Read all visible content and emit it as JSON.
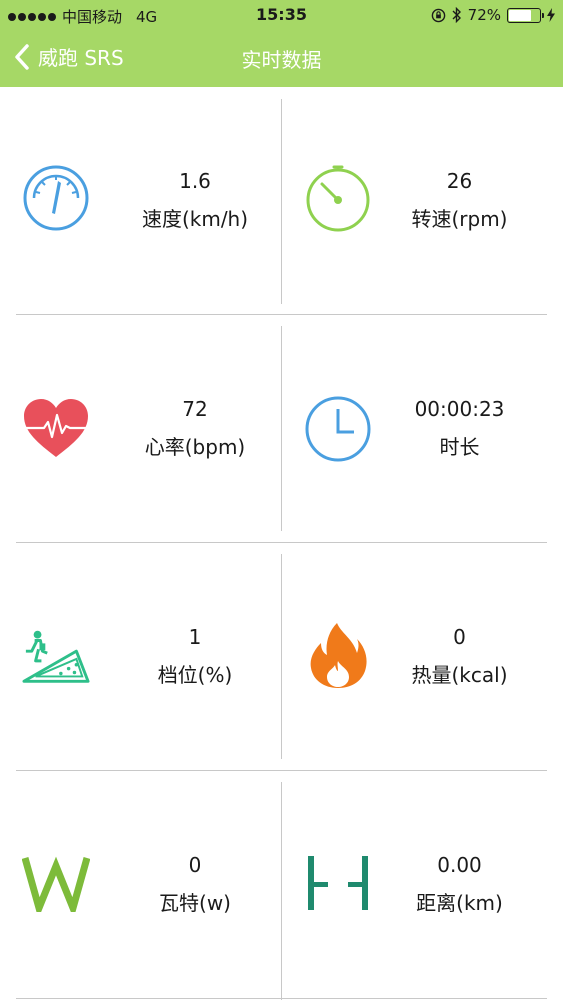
{
  "status_bar": {
    "carrier": "中国移动",
    "network": "4G",
    "time": "15:35",
    "battery": "72%",
    "battery_level": 0.72
  },
  "nav": {
    "back_label": "威跑 SRS",
    "title": "实时数据"
  },
  "metrics": [
    {
      "value": "1.6",
      "label": "速度(km/h)",
      "icon": "speedometer-icon",
      "color": "#4a9fe0"
    },
    {
      "value": "26",
      "label": "转速(rpm)",
      "icon": "rpm-dial-icon",
      "color": "#8fd14f"
    },
    {
      "value": "72",
      "label": "心率(bpm)",
      "icon": "heart-rate-icon",
      "color": "#e8505b"
    },
    {
      "value": "00:00:23",
      "label": "时长",
      "icon": "clock-icon",
      "color": "#4a9fe0"
    },
    {
      "value": "1",
      "label": "档位(%)",
      "icon": "incline-icon",
      "color": "#2ebf8a"
    },
    {
      "value": "0",
      "label": "热量(kcal)",
      "icon": "flame-icon",
      "color": "#f07a1a"
    },
    {
      "value": "0",
      "label": "瓦特(w)",
      "icon": "watt-icon",
      "color": "#7dbb3a"
    },
    {
      "value": "0.00",
      "label": "距离(km)",
      "icon": "distance-icon",
      "color": "#1f8a6e"
    }
  ],
  "colors": {
    "header_bg": "#a6d866",
    "divider": "#c8c8c8"
  }
}
